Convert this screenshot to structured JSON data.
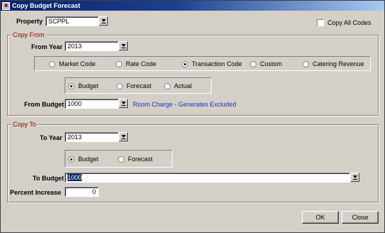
{
  "window": {
    "title": "Copy Budget Forecast"
  },
  "property": {
    "label": "Property",
    "value": "SCPPL"
  },
  "copy_all_codes": {
    "label": "Copy All Codes",
    "checked": false
  },
  "copy_from": {
    "title": "Copy From",
    "from_year_label": "From Year",
    "from_year_value": "2013",
    "code_types": [
      {
        "label": "Market Code",
        "selected": false
      },
      {
        "label": "Rate Code",
        "selected": false
      },
      {
        "label": "Transaction Code",
        "selected": true
      },
      {
        "label": "Custom",
        "selected": false
      },
      {
        "label": "Catering Revenue",
        "selected": false
      }
    ],
    "budget_types": [
      {
        "label": "Budget",
        "selected": true
      },
      {
        "label": "Forecast",
        "selected": false
      },
      {
        "label": "Actual",
        "selected": false
      }
    ],
    "from_budget_label": "From Budget",
    "from_budget_value": "1000",
    "from_budget_desc": "Room Charge - Generates Excluded"
  },
  "copy_to": {
    "title": "Copy To",
    "to_year_label": "To Year",
    "to_year_value": "2013",
    "budget_types": [
      {
        "label": "Budget",
        "selected": true
      },
      {
        "label": "Forecast",
        "selected": false
      }
    ],
    "to_budget_label": "To Budget",
    "to_budget_value": "1000",
    "percent_label": "Percent Increase",
    "percent_value": "0"
  },
  "buttons": {
    "ok": "OK",
    "close": "Close"
  },
  "icons": {
    "app": "app-icon",
    "dropdown": "dropdown-arrow-icon"
  }
}
